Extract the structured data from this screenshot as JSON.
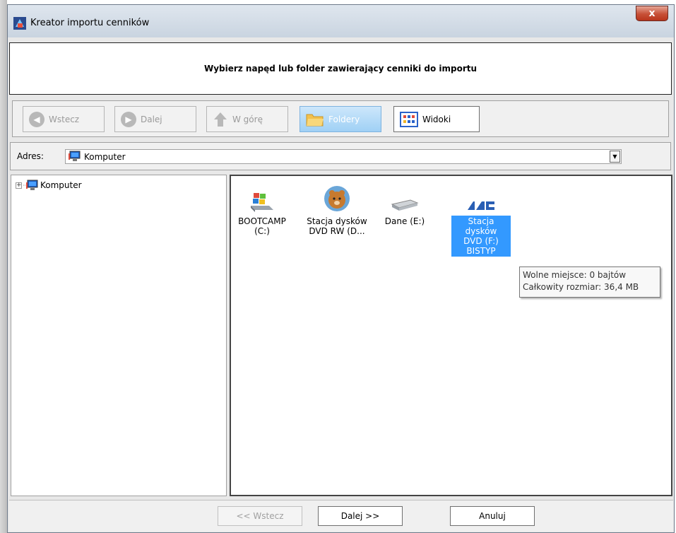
{
  "window": {
    "title": "Kreator importu cenników",
    "close_label": "x"
  },
  "header": {
    "text": "Wybierz napęd lub folder zawierający cenniki do importu"
  },
  "toolbar": {
    "back_label": "Wstecz",
    "forward_label": "Dalej",
    "up_label": "W górę",
    "folders_label": "Foldery",
    "views_label": "Widoki"
  },
  "address": {
    "label": "Adres:",
    "value": "Komputer"
  },
  "tree": {
    "root_label": "Komputer",
    "expander": "+"
  },
  "drives": [
    {
      "line1": "BOOTCAMP",
      "line2": "(C:)"
    },
    {
      "line1": "Stacja dysków",
      "line2": "DVD RW (D..."
    },
    {
      "line1": "Dane (E:)",
      "line2": ""
    },
    {
      "line1": "Stacja dysków",
      "line2": "DVD (F:)",
      "line3": "BISTYP"
    }
  ],
  "tooltip": {
    "line1": "Wolne miejsce: 0 bajtów",
    "line2": "Całkowity rozmiar: 36,4 MB"
  },
  "footer": {
    "back_label": "<< Wstecz",
    "next_label": "Dalej >>",
    "cancel_label": "Anuluj"
  },
  "colors": {
    "selection": "#3399ff",
    "close_button": "#c74f36",
    "folders_active": "#9fd0f5"
  }
}
